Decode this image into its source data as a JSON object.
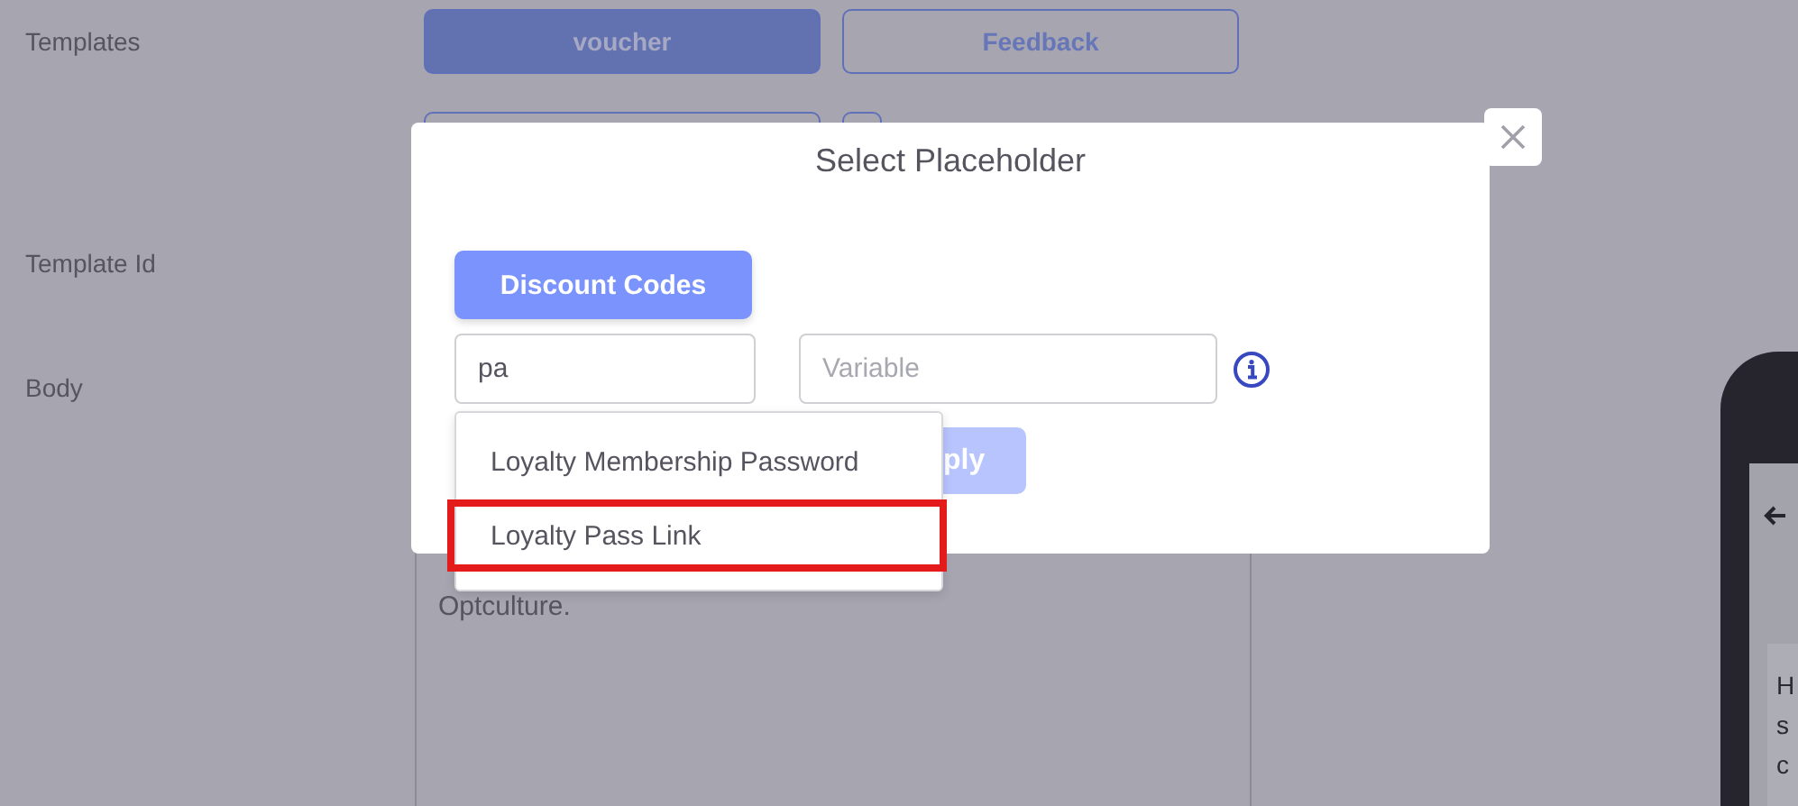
{
  "templates": {
    "label": "Templates",
    "options": [
      {
        "label": "voucher",
        "selected": true
      },
      {
        "label": "Feedback",
        "selected": false
      }
    ]
  },
  "template_id": {
    "label": "Template Id"
  },
  "body": {
    "label": "Body",
    "text": "Optculture."
  },
  "phone_preview": {
    "lines": [
      "H",
      "s",
      "c"
    ]
  },
  "dialog": {
    "title": "Select Placeholder",
    "category_button": "Discount Codes",
    "search": {
      "value": "pa"
    },
    "variable": {
      "placeholder": "Variable"
    },
    "apply_button": "ply",
    "suggestions": [
      {
        "label": "Loyalty Membership Password",
        "highlighted": false
      },
      {
        "label": "Loyalty Pass Link",
        "highlighted": true
      }
    ]
  }
}
